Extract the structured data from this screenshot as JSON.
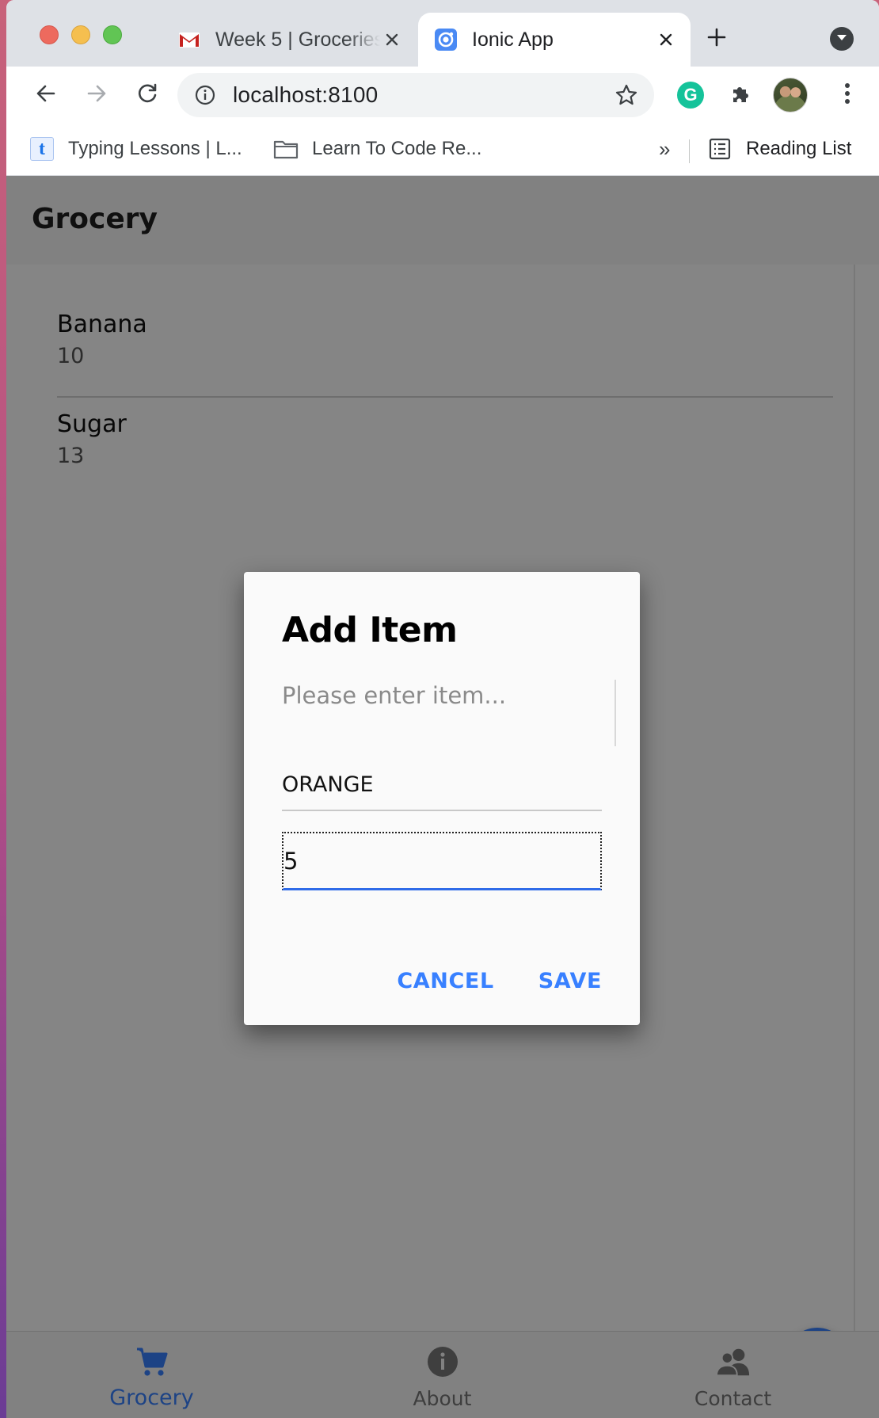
{
  "browser": {
    "tabs": [
      {
        "title": "Week 5 | Groceries",
        "favicon": "gmail-icon",
        "active": false
      },
      {
        "title": "Ionic App",
        "favicon": "ionic-icon",
        "active": true
      }
    ],
    "url": "localhost:8100",
    "bookmarks": [
      {
        "label": "Typing Lessons | L...",
        "icon": "t-icon"
      },
      {
        "label": "Learn To Code Re...",
        "icon": "folder-icon"
      }
    ],
    "more_bookmarks": "»",
    "reading_list": "Reading List"
  },
  "app": {
    "header_title": "Grocery",
    "items": [
      {
        "name": "Banana",
        "quantity": "10"
      },
      {
        "name": "Sugar",
        "quantity": "13"
      }
    ],
    "tabs": [
      {
        "label": "Grocery",
        "icon": "cart-icon",
        "selected": true
      },
      {
        "label": "About",
        "icon": "info-icon",
        "selected": false
      },
      {
        "label": "Contact",
        "icon": "people-icon",
        "selected": false
      }
    ],
    "accent_color": "#3880ff"
  },
  "dialog": {
    "title": "Add Item",
    "name_input": {
      "placeholder": "Please enter item...",
      "value": ""
    },
    "second_input": {
      "value": "ORANGE"
    },
    "quantity_input": {
      "value": "5"
    },
    "cancel_label": "CANCEL",
    "save_label": "SAVE"
  }
}
